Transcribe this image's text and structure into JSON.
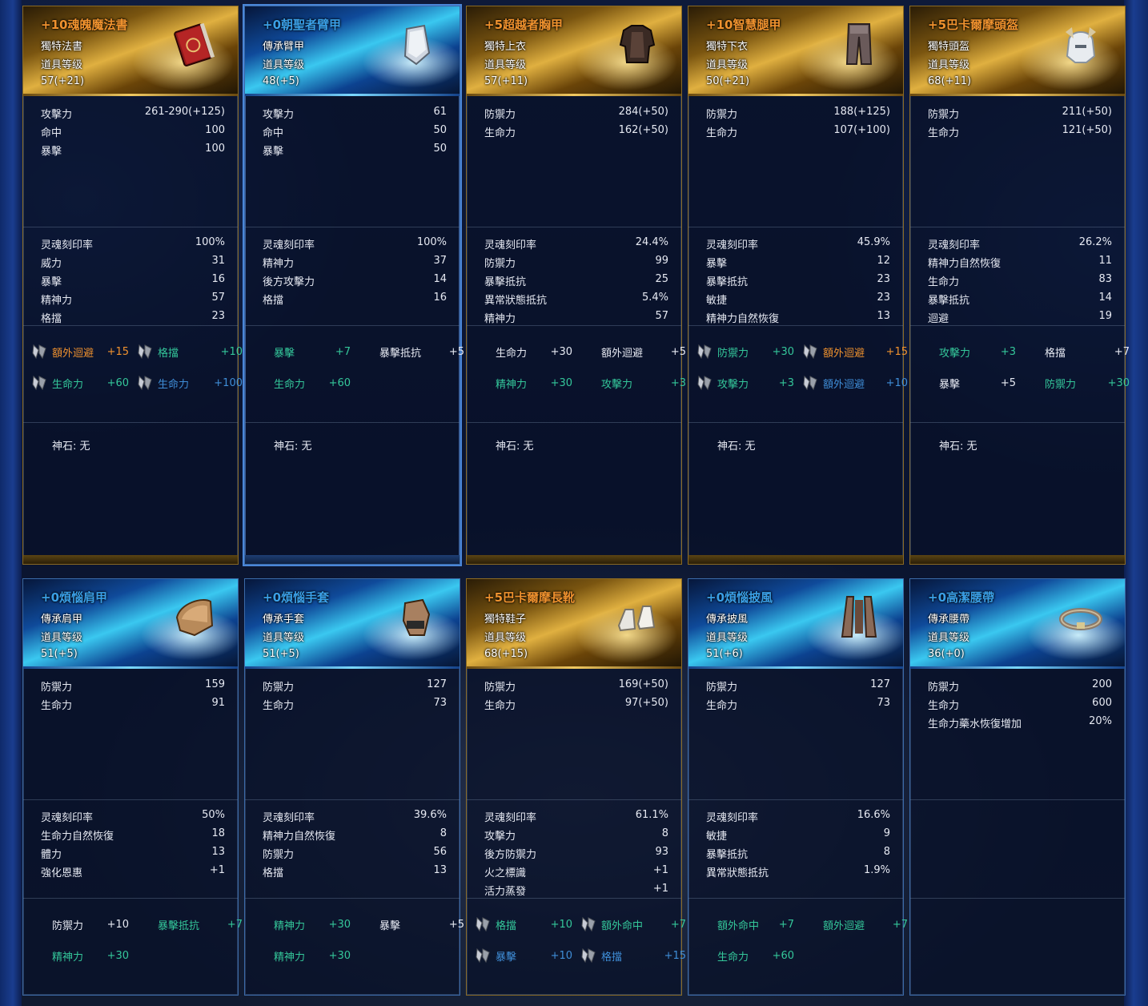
{
  "base_label": "道具等级",
  "stone_label": "神石: 无",
  "cards": [
    {
      "tier": "gold",
      "name": "+10魂魄魔法書",
      "type": "獨特法書",
      "level": "57(+21)",
      "icon": "book-icon",
      "base": [
        [
          "攻擊力",
          "261-290(+125)"
        ],
        [
          "命中",
          "100"
        ],
        [
          "暴擊",
          "100"
        ]
      ],
      "soul": [
        [
          "灵魂刻印率",
          "100%"
        ],
        [
          "威力",
          "31"
        ],
        [
          "暴擊",
          "16"
        ],
        [
          "精神力",
          "57"
        ],
        [
          "格擋",
          "23"
        ]
      ],
      "bonus": [
        {
          "icon": true,
          "label": "額外迴避",
          "value": "+15",
          "color": "or"
        },
        {
          "icon": true,
          "label": "格擋",
          "value": "+10",
          "color": "gr"
        },
        {
          "icon": true,
          "label": "生命力",
          "value": "+60",
          "color": "gr"
        },
        {
          "icon": true,
          "label": "生命力",
          "value": "+100",
          "color": "bl"
        }
      ]
    },
    {
      "tier": "blue",
      "name": "+0朝聖者臂甲",
      "type": "傳承臂甲",
      "level": "48(+5)",
      "icon": "vambrace-icon",
      "selected": true,
      "base": [
        [
          "攻擊力",
          "61"
        ],
        [
          "命中",
          "50"
        ],
        [
          "暴擊",
          "50"
        ]
      ],
      "soul": [
        [
          "灵魂刻印率",
          "100%"
        ],
        [
          "精神力",
          "37"
        ],
        [
          "後方攻擊力",
          "14"
        ],
        [
          "格擋",
          "16"
        ]
      ],
      "bonus": [
        {
          "icon": false,
          "label": "暴擊",
          "value": "+7",
          "color": "gr"
        },
        {
          "icon": false,
          "label": "暴擊抵抗",
          "value": "+5",
          "color": "wh"
        },
        {
          "icon": false,
          "label": "生命力",
          "value": "+60",
          "color": "gr"
        }
      ]
    },
    {
      "tier": "gold",
      "name": "+5超越者胸甲",
      "type": "獨特上衣",
      "level": "57(+11)",
      "icon": "chest-armor-icon",
      "base": [
        [
          "防禦力",
          "284(+50)"
        ],
        [
          "生命力",
          "162(+50)"
        ]
      ],
      "soul": [
        [
          "灵魂刻印率",
          "24.4%"
        ],
        [
          "防禦力",
          "99"
        ],
        [
          "暴擊抵抗",
          "25"
        ],
        [
          "異常狀態抵抗",
          "5.4%"
        ],
        [
          "精神力",
          "57"
        ]
      ],
      "bonus": [
        {
          "icon": false,
          "label": "生命力",
          "value": "+30",
          "color": "wh"
        },
        {
          "icon": false,
          "label": "額外迴避",
          "value": "+5",
          "color": "wh"
        },
        {
          "icon": false,
          "label": "精神力",
          "value": "+30",
          "color": "gr"
        },
        {
          "icon": false,
          "label": "攻擊力",
          "value": "+3",
          "color": "gr"
        }
      ]
    },
    {
      "tier": "gold",
      "name": "+10智慧腿甲",
      "type": "獨特下衣",
      "level": "50(+21)",
      "icon": "leg-armor-icon",
      "base": [
        [
          "防禦力",
          "188(+125)"
        ],
        [
          "生命力",
          "107(+100)"
        ]
      ],
      "soul": [
        [
          "灵魂刻印率",
          "45.9%"
        ],
        [
          "暴擊",
          "12"
        ],
        [
          "暴擊抵抗",
          "23"
        ],
        [
          "敏捷",
          "23"
        ],
        [
          "精神力自然恢復",
          "13"
        ]
      ],
      "bonus": [
        {
          "icon": true,
          "label": "防禦力",
          "value": "+30",
          "color": "gr"
        },
        {
          "icon": true,
          "label": "額外迴避",
          "value": "+15",
          "color": "or"
        },
        {
          "icon": true,
          "label": "攻擊力",
          "value": "+3",
          "color": "gr"
        },
        {
          "icon": true,
          "label": "額外迴避",
          "value": "+10",
          "color": "bl"
        }
      ]
    },
    {
      "tier": "gold",
      "name": "+5巴卡爾摩頭盔",
      "type": "獨特頭盔",
      "level": "68(+11)",
      "icon": "helmet-icon",
      "base": [
        [
          "防禦力",
          "211(+50)"
        ],
        [
          "生命力",
          "121(+50)"
        ]
      ],
      "soul": [
        [
          "灵魂刻印率",
          "26.2%"
        ],
        [
          "精神力自然恢復",
          "11"
        ],
        [
          "生命力",
          "83"
        ],
        [
          "暴擊抵抗",
          "14"
        ],
        [
          "迴避",
          "19"
        ]
      ],
      "bonus": [
        {
          "icon": false,
          "label": "攻擊力",
          "value": "+3",
          "color": "gr"
        },
        {
          "icon": false,
          "label": "格擋",
          "value": "+7",
          "color": "wh"
        },
        {
          "icon": false,
          "label": "暴擊",
          "value": "+5",
          "color": "wh"
        },
        {
          "icon": false,
          "label": "防禦力",
          "value": "+30",
          "color": "gr"
        }
      ]
    },
    {
      "tier": "blue",
      "name": "+0煩惱肩甲",
      "type": "傳承肩甲",
      "level": "51(+5)",
      "icon": "shoulder-armor-icon",
      "base": [
        [
          "防禦力",
          "159"
        ],
        [
          "生命力",
          "91"
        ]
      ],
      "soul": [
        [
          "灵魂刻印率",
          "50%"
        ],
        [
          "生命力自然恢復",
          "18"
        ],
        [
          "體力",
          "13"
        ],
        [
          "強化恩惠",
          "+1"
        ]
      ],
      "bonus": [
        {
          "icon": false,
          "label": "防禦力",
          "value": "+10",
          "color": "wh"
        },
        {
          "icon": false,
          "label": "暴擊抵抗",
          "value": "+7",
          "color": "gr"
        },
        {
          "icon": false,
          "label": "精神力",
          "value": "+30",
          "color": "gr"
        }
      ]
    },
    {
      "tier": "blue",
      "name": "+0煩惱手套",
      "type": "傳承手套",
      "level": "51(+5)",
      "icon": "glove-icon",
      "base": [
        [
          "防禦力",
          "127"
        ],
        [
          "生命力",
          "73"
        ]
      ],
      "soul": [
        [
          "灵魂刻印率",
          "39.6%"
        ],
        [
          "精神力自然恢復",
          "8"
        ],
        [
          "防禦力",
          "56"
        ],
        [
          "格擋",
          "13"
        ]
      ],
      "bonus": [
        {
          "icon": false,
          "label": "精神力",
          "value": "+30",
          "color": "gr"
        },
        {
          "icon": false,
          "label": "暴擊",
          "value": "+5",
          "color": "wh"
        },
        {
          "icon": false,
          "label": "精神力",
          "value": "+30",
          "color": "gr"
        }
      ]
    },
    {
      "tier": "gold",
      "name": "+5巴卡爾摩長靴",
      "type": "獨特鞋子",
      "level": "68(+15)",
      "icon": "boots-icon",
      "base": [
        [
          "防禦力",
          "169(+50)"
        ],
        [
          "生命力",
          "97(+50)"
        ]
      ],
      "soul": [
        [
          "灵魂刻印率",
          "61.1%"
        ],
        [
          "攻擊力",
          "8"
        ],
        [
          "後方防禦力",
          "93"
        ],
        [
          "火之標識",
          "+1"
        ],
        [
          "活力蒸發",
          "+1"
        ]
      ],
      "bonus": [
        {
          "icon": true,
          "label": "格擋",
          "value": "+10",
          "color": "gr"
        },
        {
          "icon": true,
          "label": "額外命中",
          "value": "+7",
          "color": "gr"
        },
        {
          "icon": true,
          "label": "暴擊",
          "value": "+10",
          "color": "bl"
        },
        {
          "icon": true,
          "label": "格擋",
          "value": "+15",
          "color": "bl"
        }
      ]
    },
    {
      "tier": "blue",
      "name": "+0煩惱披風",
      "type": "傳承披風",
      "level": "51(+6)",
      "icon": "cloak-icon",
      "base": [
        [
          "防禦力",
          "127"
        ],
        [
          "生命力",
          "73"
        ]
      ],
      "soul": [
        [
          "灵魂刻印率",
          "16.6%"
        ],
        [
          "敏捷",
          "9"
        ],
        [
          "暴擊抵抗",
          "8"
        ],
        [
          "異常狀態抵抗",
          "1.9%"
        ]
      ],
      "bonus": [
        {
          "icon": false,
          "label": "額外命中",
          "value": "+7",
          "color": "gr"
        },
        {
          "icon": false,
          "label": "額外迴避",
          "value": "+7",
          "color": "gr"
        },
        {
          "icon": false,
          "label": "生命力",
          "value": "+60",
          "color": "gr"
        }
      ]
    },
    {
      "tier": "blue",
      "name": "+0高潔腰帶",
      "type": "傳承腰帶",
      "level": "36(+0)",
      "icon": "belt-icon",
      "base": [
        [
          "防禦力",
          "200"
        ],
        [
          "生命力",
          "600"
        ],
        [
          "生命力藥水恢復增加",
          "20%"
        ]
      ],
      "soul": [],
      "bonus": []
    }
  ]
}
